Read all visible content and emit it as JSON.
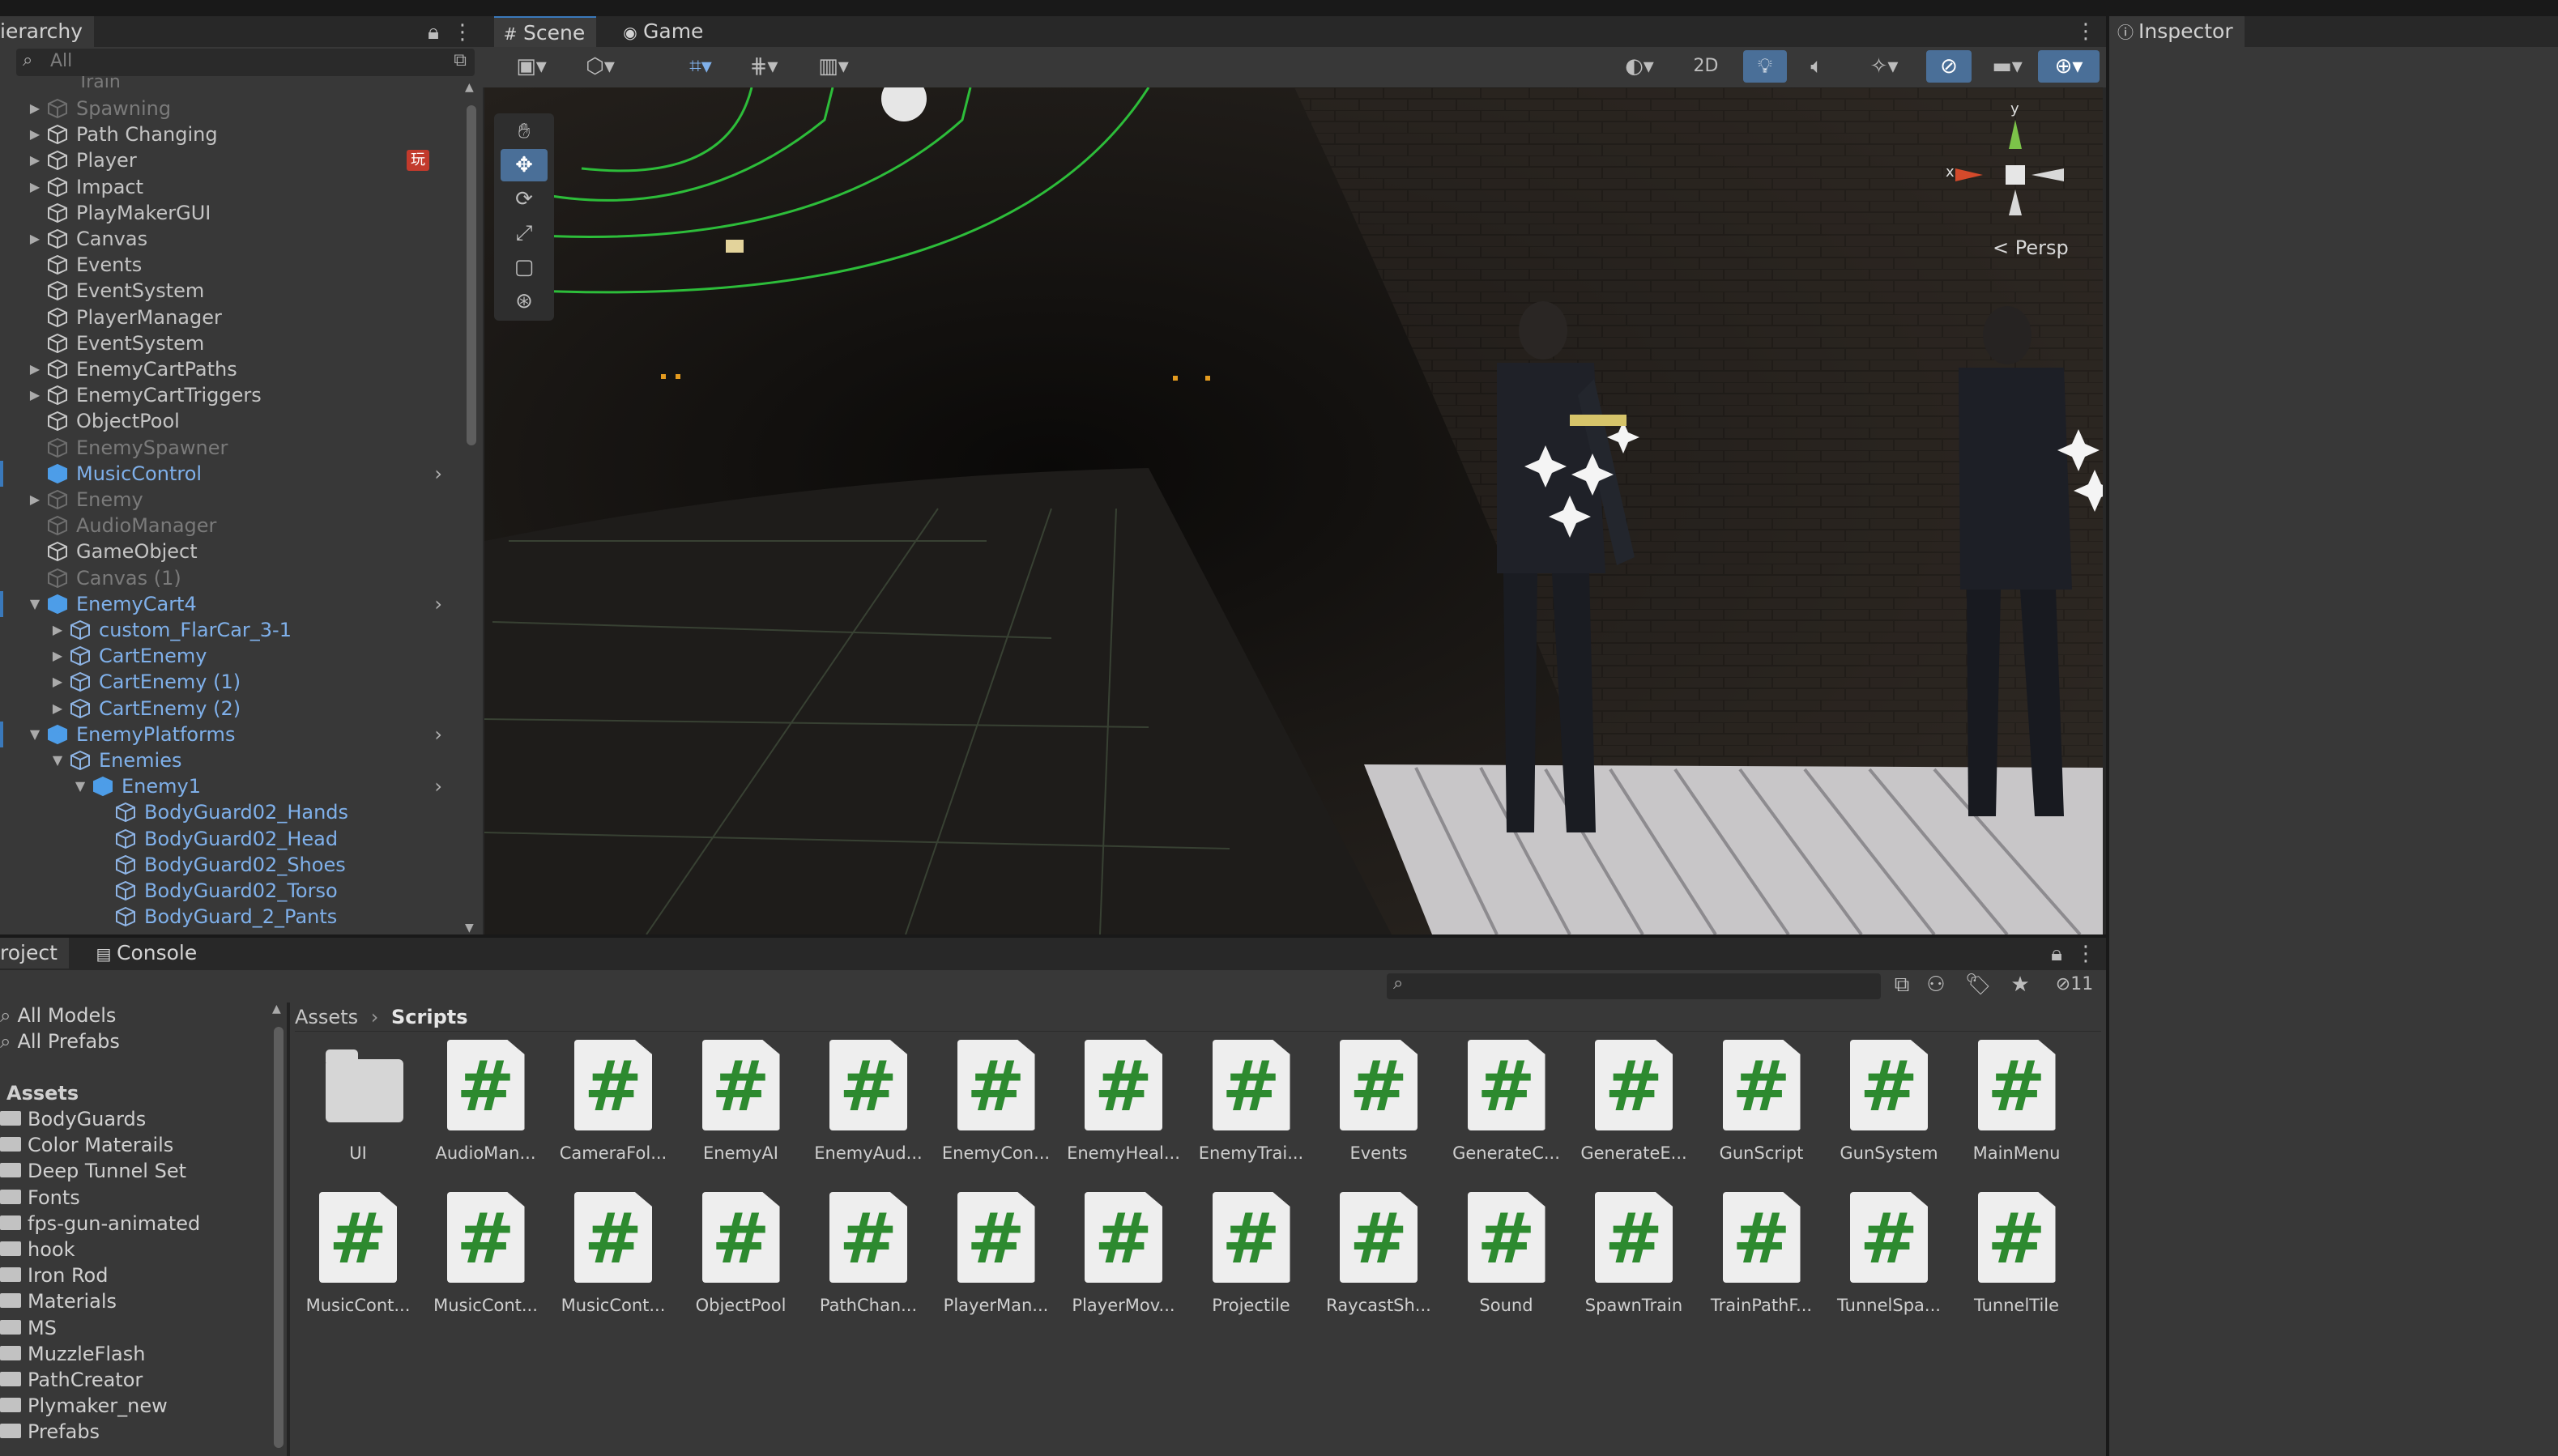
{
  "hierarchy": {
    "tab_label": "ierarchy",
    "search_placeholder": "All",
    "partial_top": "Train",
    "items": [
      {
        "label": "Spawning",
        "state": "dim",
        "expander": true
      },
      {
        "label": "Path Changing",
        "state": "normal",
        "expander": true
      },
      {
        "label": "Player",
        "state": "normal",
        "expander": true,
        "badge": "玩"
      },
      {
        "label": "Impact",
        "state": "normal",
        "expander": true
      },
      {
        "label": "PlayMakerGUI",
        "state": "normal",
        "expander": false
      },
      {
        "label": "Canvas",
        "state": "normal",
        "expander": true
      },
      {
        "label": "Events",
        "state": "normal",
        "expander": false
      },
      {
        "label": "EventSystem",
        "state": "normal",
        "expander": false
      },
      {
        "label": "PlayerManager",
        "state": "normal",
        "expander": false
      },
      {
        "label": "EventSystem",
        "state": "normal",
        "expander": false
      },
      {
        "label": "EnemyCartPaths",
        "state": "normal",
        "expander": true
      },
      {
        "label": "EnemyCartTriggers",
        "state": "normal",
        "expander": true
      },
      {
        "label": "ObjectPool",
        "state": "normal",
        "expander": false
      },
      {
        "label": "EnemySpawner",
        "state": "dim",
        "expander": false
      },
      {
        "label": "MusicControl",
        "state": "prefab",
        "expander": false,
        "chevron": true,
        "selected": true
      },
      {
        "label": "Enemy",
        "state": "dim",
        "expander": true
      },
      {
        "label": "AudioManager",
        "state": "dim",
        "expander": false
      },
      {
        "label": "GameObject",
        "state": "normal",
        "expander": false
      },
      {
        "label": "Canvas (1)",
        "state": "dim",
        "expander": false
      },
      {
        "label": "EnemyCart4",
        "state": "prefab",
        "expander": "open",
        "chevron": true,
        "selected": true
      },
      {
        "label": "custom_FlarCar_3-1",
        "state": "blue",
        "expander": true,
        "indent": 1
      },
      {
        "label": "CartEnemy",
        "state": "blue",
        "expander": true,
        "indent": 1
      },
      {
        "label": "CartEnemy (1)",
        "state": "blue",
        "expander": true,
        "indent": 1
      },
      {
        "label": "CartEnemy (2)",
        "state": "blue",
        "expander": true,
        "indent": 1
      },
      {
        "label": "EnemyPlatforms",
        "state": "prefab",
        "expander": "open",
        "chevron": true,
        "selected": true
      },
      {
        "label": "Enemies",
        "state": "blue",
        "expander": "open",
        "indent": 1
      },
      {
        "label": "Enemy1",
        "state": "prefab",
        "expander": "open",
        "indent": 2,
        "chevron": true
      },
      {
        "label": "BodyGuard02_Hands",
        "state": "blue",
        "expander": false,
        "indent": 3
      },
      {
        "label": "BodyGuard02_Head",
        "state": "blue",
        "expander": false,
        "indent": 3
      },
      {
        "label": "BodyGuard02_Shoes",
        "state": "blue",
        "expander": false,
        "indent": 3
      },
      {
        "label": "BodyGuard02_Torso",
        "state": "blue",
        "expander": false,
        "indent": 3
      },
      {
        "label": "BodyGuard_2_Pants",
        "state": "blue",
        "expander": false,
        "indent": 3
      }
    ]
  },
  "scene": {
    "tabs": [
      {
        "label": "Scene",
        "icon": "#"
      },
      {
        "label": "Game",
        "icon": "◉"
      }
    ],
    "toolbar_2d": "2D",
    "persp_label": "< Persp",
    "gizmo_x": "x",
    "gizmo_y": "y"
  },
  "inspector": {
    "tab_label": "Inspector"
  },
  "project": {
    "tabs": [
      "roject",
      "Console"
    ],
    "visibility_count": "11",
    "breadcrumb": [
      "Assets",
      "Scripts"
    ],
    "sidebar": {
      "favorites": [
        "All Models",
        "All Prefabs"
      ],
      "assets_header": "Assets",
      "folders": [
        "BodyGuards",
        "Color Materails",
        "Deep Tunnel Set",
        "Fonts",
        "fps-gun-animated",
        "hook",
        "Iron Rod",
        "Materials",
        "MS",
        "MuzzleFlash",
        "PathCreator",
        "Plymaker_new",
        "Prefabs"
      ]
    },
    "assets_row1": [
      {
        "name": "UI",
        "kind": "folder"
      },
      {
        "name": "AudioMan...",
        "kind": "script"
      },
      {
        "name": "CameraFol...",
        "kind": "script"
      },
      {
        "name": "EnemyAI",
        "kind": "script"
      },
      {
        "name": "EnemyAud...",
        "kind": "script"
      },
      {
        "name": "EnemyCon...",
        "kind": "script"
      },
      {
        "name": "EnemyHeal...",
        "kind": "script"
      },
      {
        "name": "EnemyTrai...",
        "kind": "script"
      },
      {
        "name": "Events",
        "kind": "script"
      },
      {
        "name": "GenerateC...",
        "kind": "script"
      },
      {
        "name": "GenerateE...",
        "kind": "script"
      },
      {
        "name": "GunScript",
        "kind": "script"
      },
      {
        "name": "GunSystem",
        "kind": "script"
      },
      {
        "name": "MainMenu",
        "kind": "script"
      }
    ],
    "assets_row2": [
      {
        "name": "MusicCont...",
        "kind": "script"
      },
      {
        "name": "MusicCont...",
        "kind": "script"
      },
      {
        "name": "MusicCont...",
        "kind": "script"
      },
      {
        "name": "ObjectPool",
        "kind": "script"
      },
      {
        "name": "PathChan...",
        "kind": "script"
      },
      {
        "name": "PlayerMan...",
        "kind": "script"
      },
      {
        "name": "PlayerMov...",
        "kind": "script"
      },
      {
        "name": "Projectile",
        "kind": "script"
      },
      {
        "name": "RaycastSh...",
        "kind": "script"
      },
      {
        "name": "Sound",
        "kind": "script"
      },
      {
        "name": "SpawnTrain",
        "kind": "script"
      },
      {
        "name": "TrainPathF...",
        "kind": "script"
      },
      {
        "name": "TunnelSpa...",
        "kind": "script"
      },
      {
        "name": "TunnelTile",
        "kind": "script"
      }
    ]
  },
  "colors": {
    "accent": "#3a79bb",
    "prefab_blue": "#7fb0ea",
    "script_green": "#2d8a2f"
  }
}
